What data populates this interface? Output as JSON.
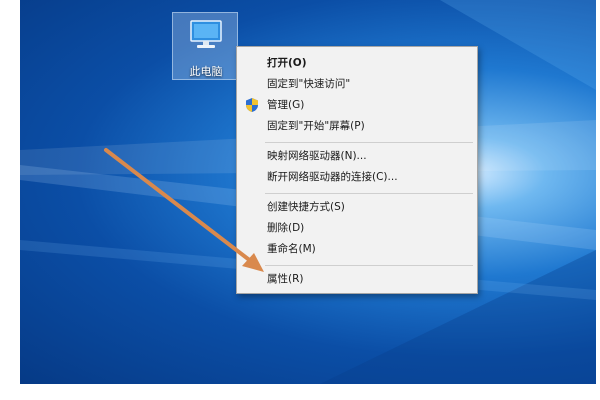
{
  "desktop": {
    "icon_label": "此电脑"
  },
  "context_menu": {
    "items": [
      {
        "label": "打开(O)",
        "bold": true
      },
      {
        "label": "固定到\"快速访问\""
      },
      {
        "label": "管理(G)",
        "icon": "shield-icon"
      },
      {
        "label": "固定到\"开始\"屏幕(P)"
      },
      {
        "label": "映射网络驱动器(N)..."
      },
      {
        "label": "断开网络驱动器的连接(C)..."
      },
      {
        "label": "创建快捷方式(S)"
      },
      {
        "label": "删除(D)"
      },
      {
        "label": "重命名(M)"
      },
      {
        "label": "属性(R)"
      }
    ]
  },
  "annotation": {
    "arrow_color": "#d9894d"
  }
}
